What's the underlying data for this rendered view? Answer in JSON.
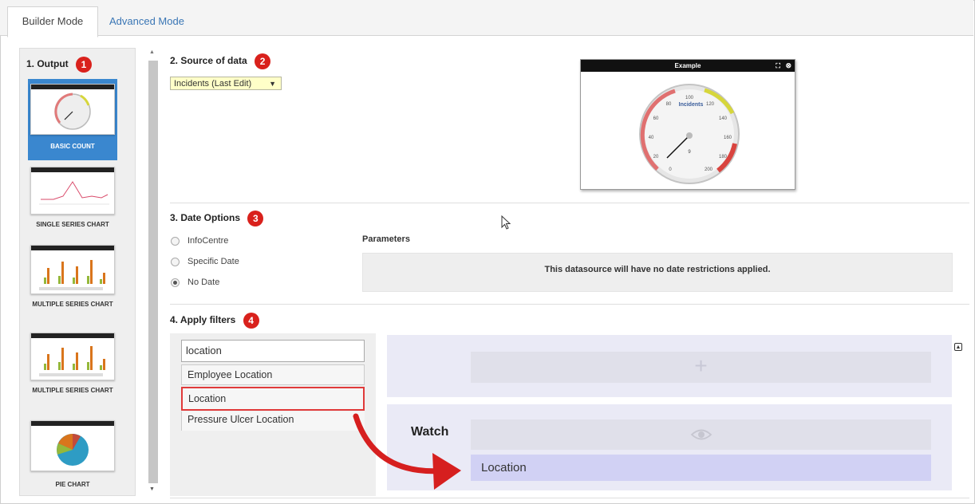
{
  "tabs": {
    "builder": "Builder Mode",
    "advanced": "Advanced Mode"
  },
  "output": {
    "title": "1. Output",
    "badge": "1",
    "items": [
      {
        "label": "BASIC COUNT"
      },
      {
        "label": "SINGLE SERIES CHART"
      },
      {
        "label": "MULTIPLE SERIES CHART"
      },
      {
        "label": "MULTIPLE SERIES CHART"
      },
      {
        "label": "PIE CHART"
      }
    ]
  },
  "source": {
    "title": "2. Source of data",
    "badge": "2",
    "selected": "Incidents (Last Edit)"
  },
  "example": {
    "title": "Example",
    "gauge_label": "Incidents",
    "gauge_value": "9",
    "ticks": [
      "0",
      "20",
      "40",
      "60",
      "80",
      "100",
      "120",
      "140",
      "160",
      "180",
      "200"
    ]
  },
  "date": {
    "title": "3. Date Options",
    "badge": "3",
    "options": [
      "InfoCentre",
      "Specific Date",
      "No Date"
    ],
    "selected": "No Date",
    "params_label": "Parameters",
    "params_message": "This datasource will have no date restrictions applied."
  },
  "filters": {
    "title": "4. Apply filters",
    "badge": "4",
    "search_value": "location",
    "suggestions": [
      "Employee Location",
      "Location",
      "Pressure Ulcer Location"
    ],
    "watch_label": "Watch",
    "watch_item": "Location"
  },
  "colors": {
    "badge": "#d9211c",
    "selected": "#3a87cf",
    "highlight": "#e03a3a",
    "watch_slot": "#d1d1f4"
  }
}
